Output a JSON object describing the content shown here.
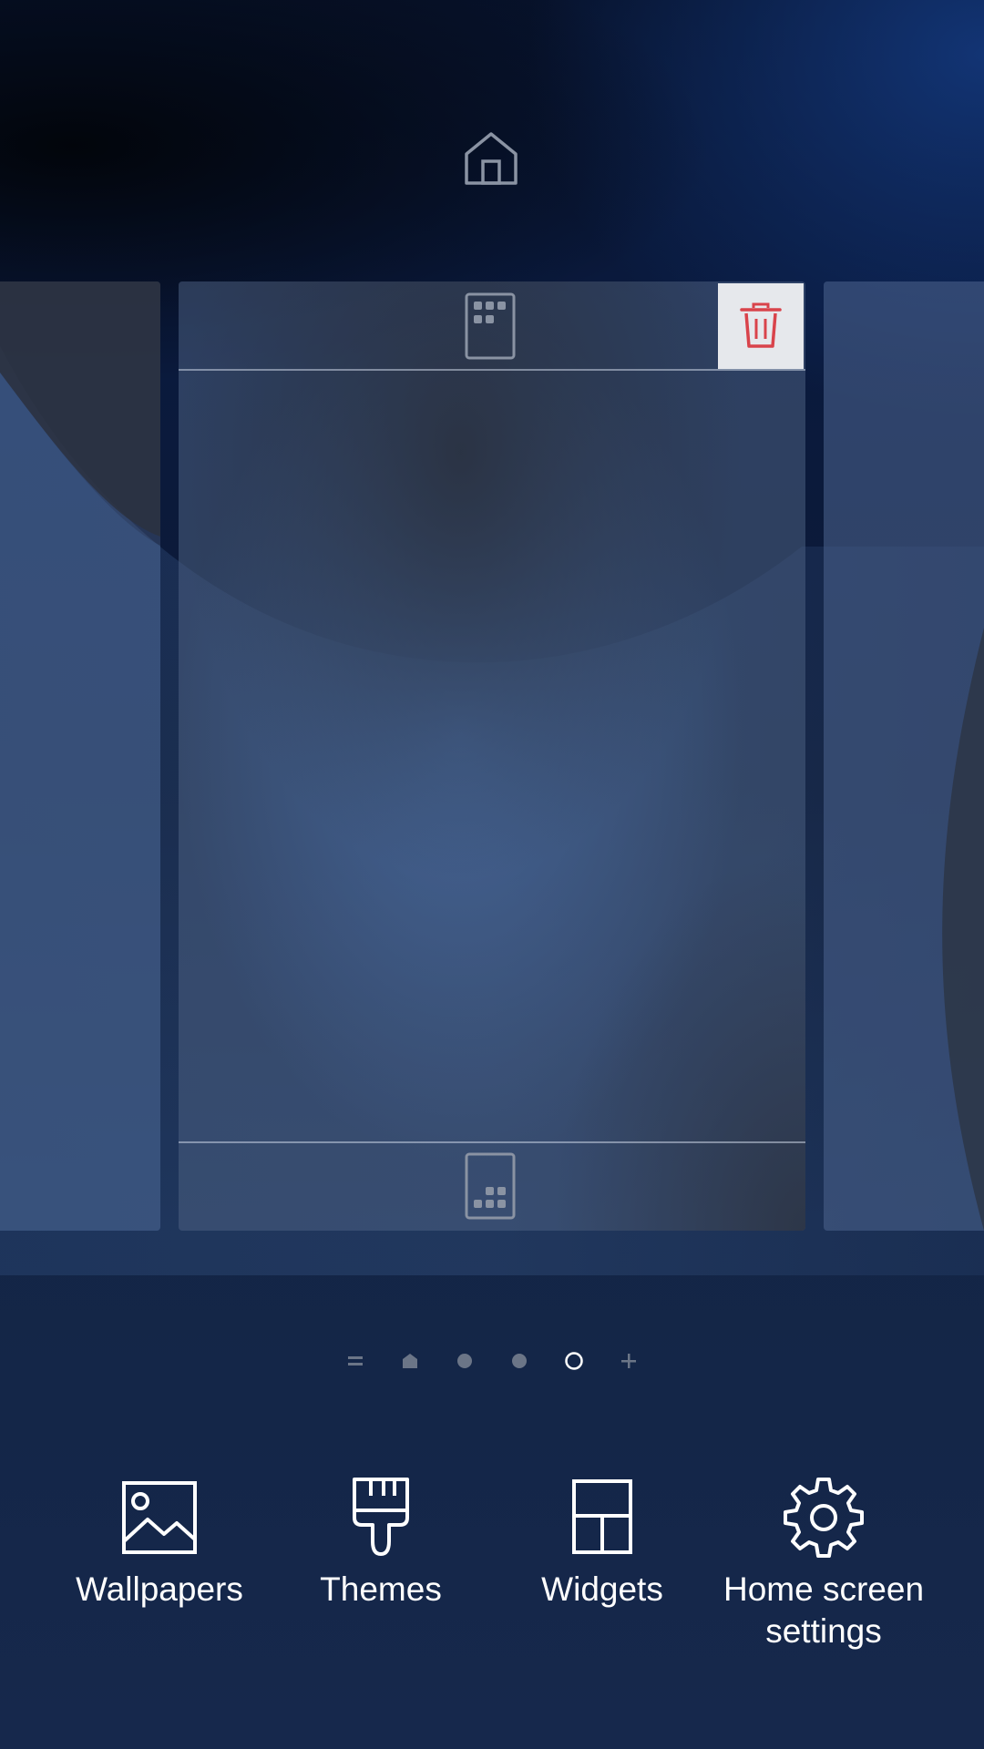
{
  "home_page_icon": "home-icon",
  "pages": {
    "current": {
      "top_icon": "apps-grid-icon",
      "bottom_icon": "apps-dock-icon",
      "delete_icon": "trash-icon"
    }
  },
  "page_indicator": [
    {
      "icon": "menu-lines-icon",
      "active": false
    },
    {
      "icon": "home-small-icon",
      "active": false
    },
    {
      "icon": "dot-icon",
      "active": false
    },
    {
      "icon": "dot-icon",
      "active": false
    },
    {
      "icon": "dot-outline-icon",
      "active": true
    },
    {
      "icon": "plus-icon",
      "active": false
    }
  ],
  "menu": {
    "wallpapers": {
      "label": "Wallpapers",
      "icon": "image-icon"
    },
    "themes": {
      "label": "Themes",
      "icon": "paintbrush-icon"
    },
    "widgets": {
      "label": "Widgets",
      "icon": "widgets-icon"
    },
    "settings": {
      "label_line1": "Home screen",
      "label_line2": "settings",
      "icon": "gear-icon"
    }
  },
  "colors": {
    "delete_accent": "#d9434b",
    "icon_gray": "#8a93a3",
    "menu_text": "#ffffff"
  }
}
